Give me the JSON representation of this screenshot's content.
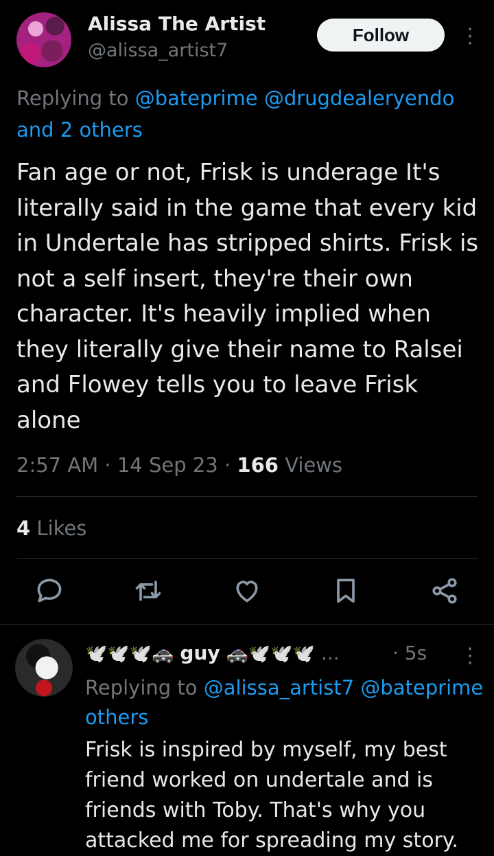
{
  "tweet": {
    "author_name": "Alissa The Artist",
    "author_handle": "@alissa_artist7",
    "follow_label": "Follow",
    "replying_prefix": "Replying to ",
    "reply_mentions": [
      "@bateprime",
      "@drugdealeryendo"
    ],
    "reply_others": "and 2 others",
    "text": "Fan age or not, Frisk is underage It's literally said in the game that every kid in Undertale has stripped shirts. Frisk is not a self insert, they're their own character. It's heavily implied when they literally give their name to Ralsei and Flowey tells you to leave Frisk alone",
    "time": "2:57 AM",
    "date": "14 Sep 23",
    "views_count": "166",
    "views_label": "Views",
    "likes_count": "4",
    "likes_label": "Likes"
  },
  "actions": [
    {
      "icon": "reply-icon"
    },
    {
      "icon": "retweet-icon"
    },
    {
      "icon": "like-icon"
    },
    {
      "icon": "bookmark-icon"
    },
    {
      "icon": "share-icon"
    }
  ],
  "reply": {
    "name_prefix_emoji": "🕊️🕊️🕊️🚓",
    "name_text": "guy",
    "name_suffix_emoji": "🚓🕊️🕊️🕊️",
    "name_ellipsis": "...",
    "time": "· 5s",
    "replying_prefix": "Replying to ",
    "mentions": [
      "@alissa_artist7",
      "@bateprime"
    ],
    "others": "others",
    "text": "Frisk is inspired by myself, my best friend worked on undertale and is friends with Toby. That's why you attacked me for spreading my story."
  },
  "colors": {
    "background": "#000000",
    "text": "#e7e9ea",
    "secondary": "#71767b",
    "link": "#1d9bf0",
    "divider": "#2f3336"
  }
}
